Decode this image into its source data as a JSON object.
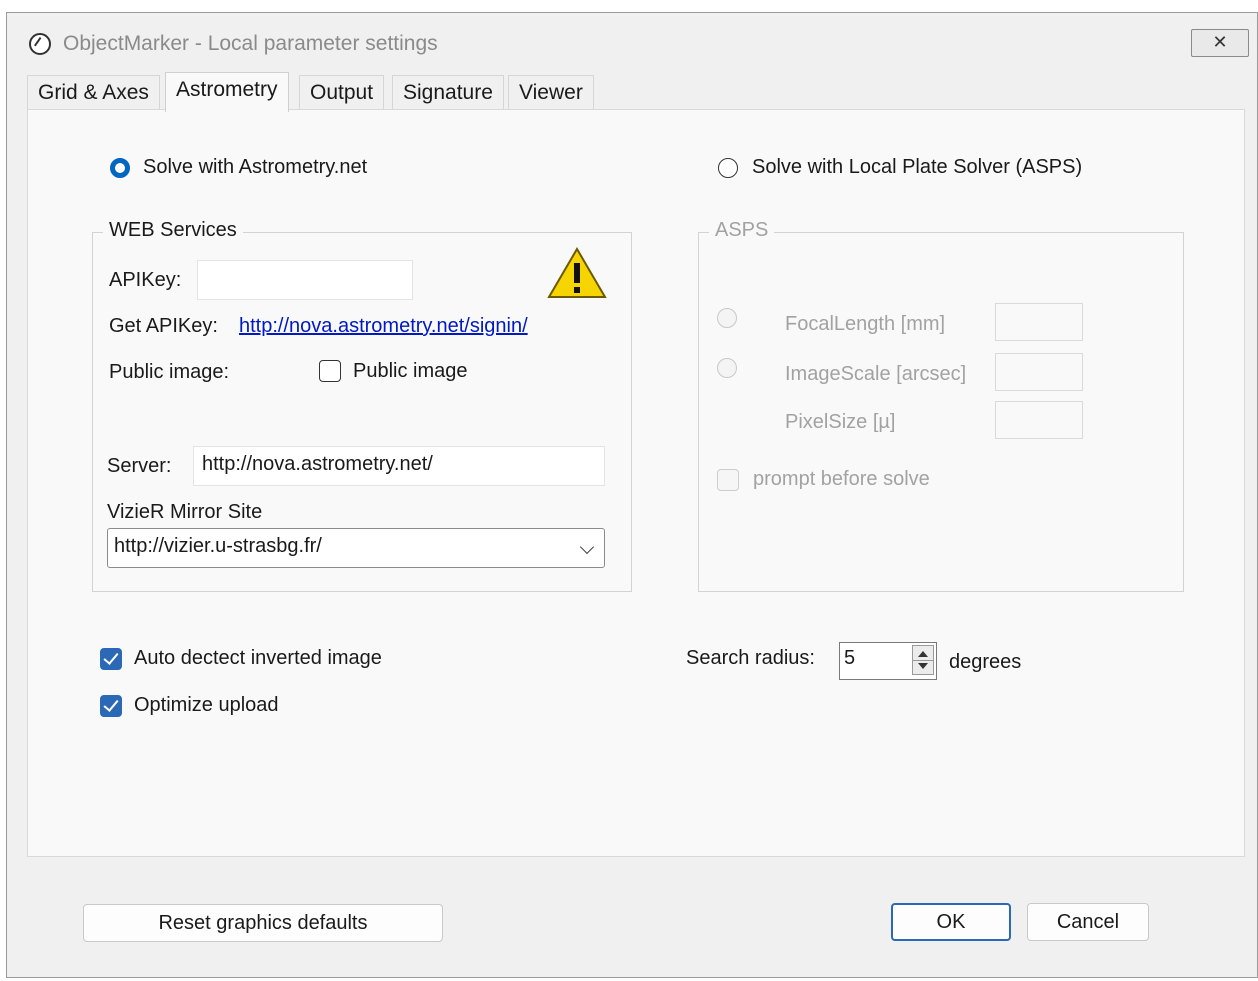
{
  "window": {
    "title": "ObjectMarker - Local parameter settings",
    "close_glyph": "✕"
  },
  "tabs": [
    {
      "label": "Grid & Axes"
    },
    {
      "label": "Astrometry",
      "active": true
    },
    {
      "label": "Output"
    },
    {
      "label": "Signature"
    },
    {
      "label": "Viewer"
    }
  ],
  "solver": {
    "astrometry_label": "Solve with Astrometry.net",
    "astrometry_selected": true,
    "local_label": "Solve with Local Plate Solver (ASPS)",
    "local_selected": false
  },
  "web_services": {
    "legend": "WEB Services",
    "apikey_label": "APIKey:",
    "apikey_value": "",
    "get_apikey_label": "Get APIKey:",
    "get_apikey_link": "http://nova.astrometry.net/signin/",
    "public_image_label": "Public image:",
    "public_image_checkbox_label": "Public image",
    "public_image_checked": false,
    "server_label": "Server:",
    "server_value": "http://nova.astrometry.net/",
    "vizier_label": "VizieR Mirror Site",
    "vizier_value": "http://vizier.u-strasbg.fr/",
    "warning_icon": "warning-triangle-icon"
  },
  "asps": {
    "legend": "ASPS",
    "focal_length_label": "FocalLength [mm]",
    "image_scale_label": "ImageScale [arcsec]",
    "pixel_size_label": "PixelSize [µ]",
    "prompt_label": "prompt before solve",
    "focal_length_value": "",
    "image_scale_value": "",
    "pixel_size_value": ""
  },
  "options": {
    "auto_detect_label": "Auto dectect inverted image",
    "auto_detect_checked": true,
    "optimize_upload_label": "Optimize upload",
    "optimize_upload_checked": true,
    "search_radius_label": "Search radius:",
    "search_radius_value": "5",
    "search_radius_unit": "degrees"
  },
  "buttons": {
    "reset_label": "Reset graphics defaults",
    "ok_label": "OK",
    "cancel_label": "Cancel"
  },
  "colors": {
    "accent": "#0067c0",
    "checkbox": "#2b68b6",
    "link": "#0019c2",
    "disabled_text": "#a2a2a2"
  }
}
